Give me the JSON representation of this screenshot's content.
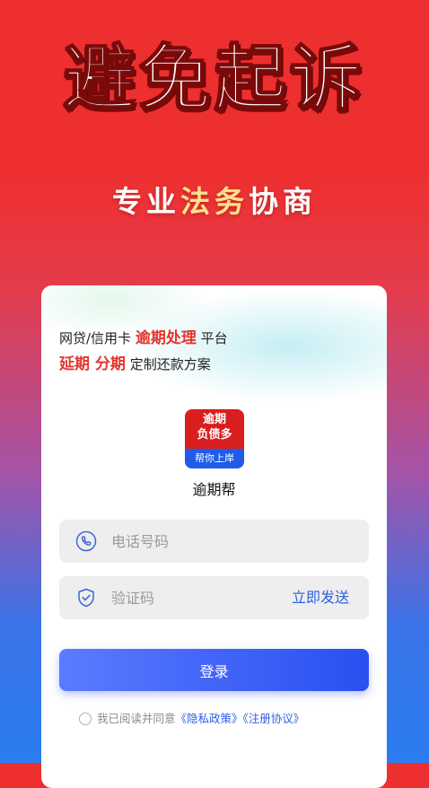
{
  "hero": {
    "title": "避免起诉",
    "subtitle_white": "专业",
    "subtitle_yellow": "法务",
    "subtitle_white2": "协商"
  },
  "promo": {
    "line1_prefix": "网贷/信用卡 ",
    "line1_highlight": "逾期处理",
    "line1_suffix": " 平台",
    "line2_highlight": "延期 分期",
    "line2_suffix": " 定制还款方案"
  },
  "app": {
    "logo_line1": "逾期",
    "logo_line2": "负债多",
    "logo_band": "帮你上岸",
    "name": "逾期帮"
  },
  "form": {
    "phone_placeholder": "电话号码",
    "code_placeholder": "验证码",
    "send_code_label": "立即发送",
    "login_label": "登录",
    "agree_text": "我已阅读并同意",
    "privacy_link": "《隐私政策》",
    "terms_link": "《注册协议》"
  },
  "colors": {
    "brand_red": "#ee2f2f",
    "accent_blue": "#2f5fe0",
    "highlight_red": "#e5362c",
    "subtitle_yellow": "#ffe08a"
  },
  "icons": {
    "phone": "phone-icon",
    "shield": "shield-check-icon",
    "radio": "radio-unchecked-icon"
  }
}
